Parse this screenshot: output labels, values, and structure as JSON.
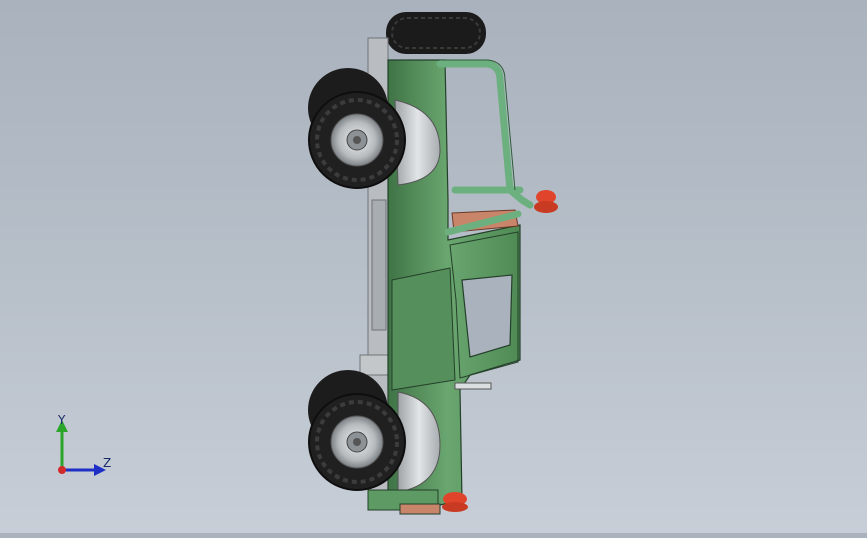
{
  "viewport": {
    "background_top": "#a9b2bd",
    "background_bottom": "#c7ced7"
  },
  "model": {
    "body_color": "#5e9a63",
    "body_dark": "#3f7446",
    "tire_color": "#1c1c1c",
    "rim_color": "#c9cccf",
    "light_color": "#e0452b",
    "frame_color": "#b9bdc1"
  },
  "triad": {
    "y_label": "Y",
    "z_label": "Z",
    "y_color": "#2aa52a",
    "z_color": "#1d2fc4",
    "x_color": "#d22a2a"
  }
}
